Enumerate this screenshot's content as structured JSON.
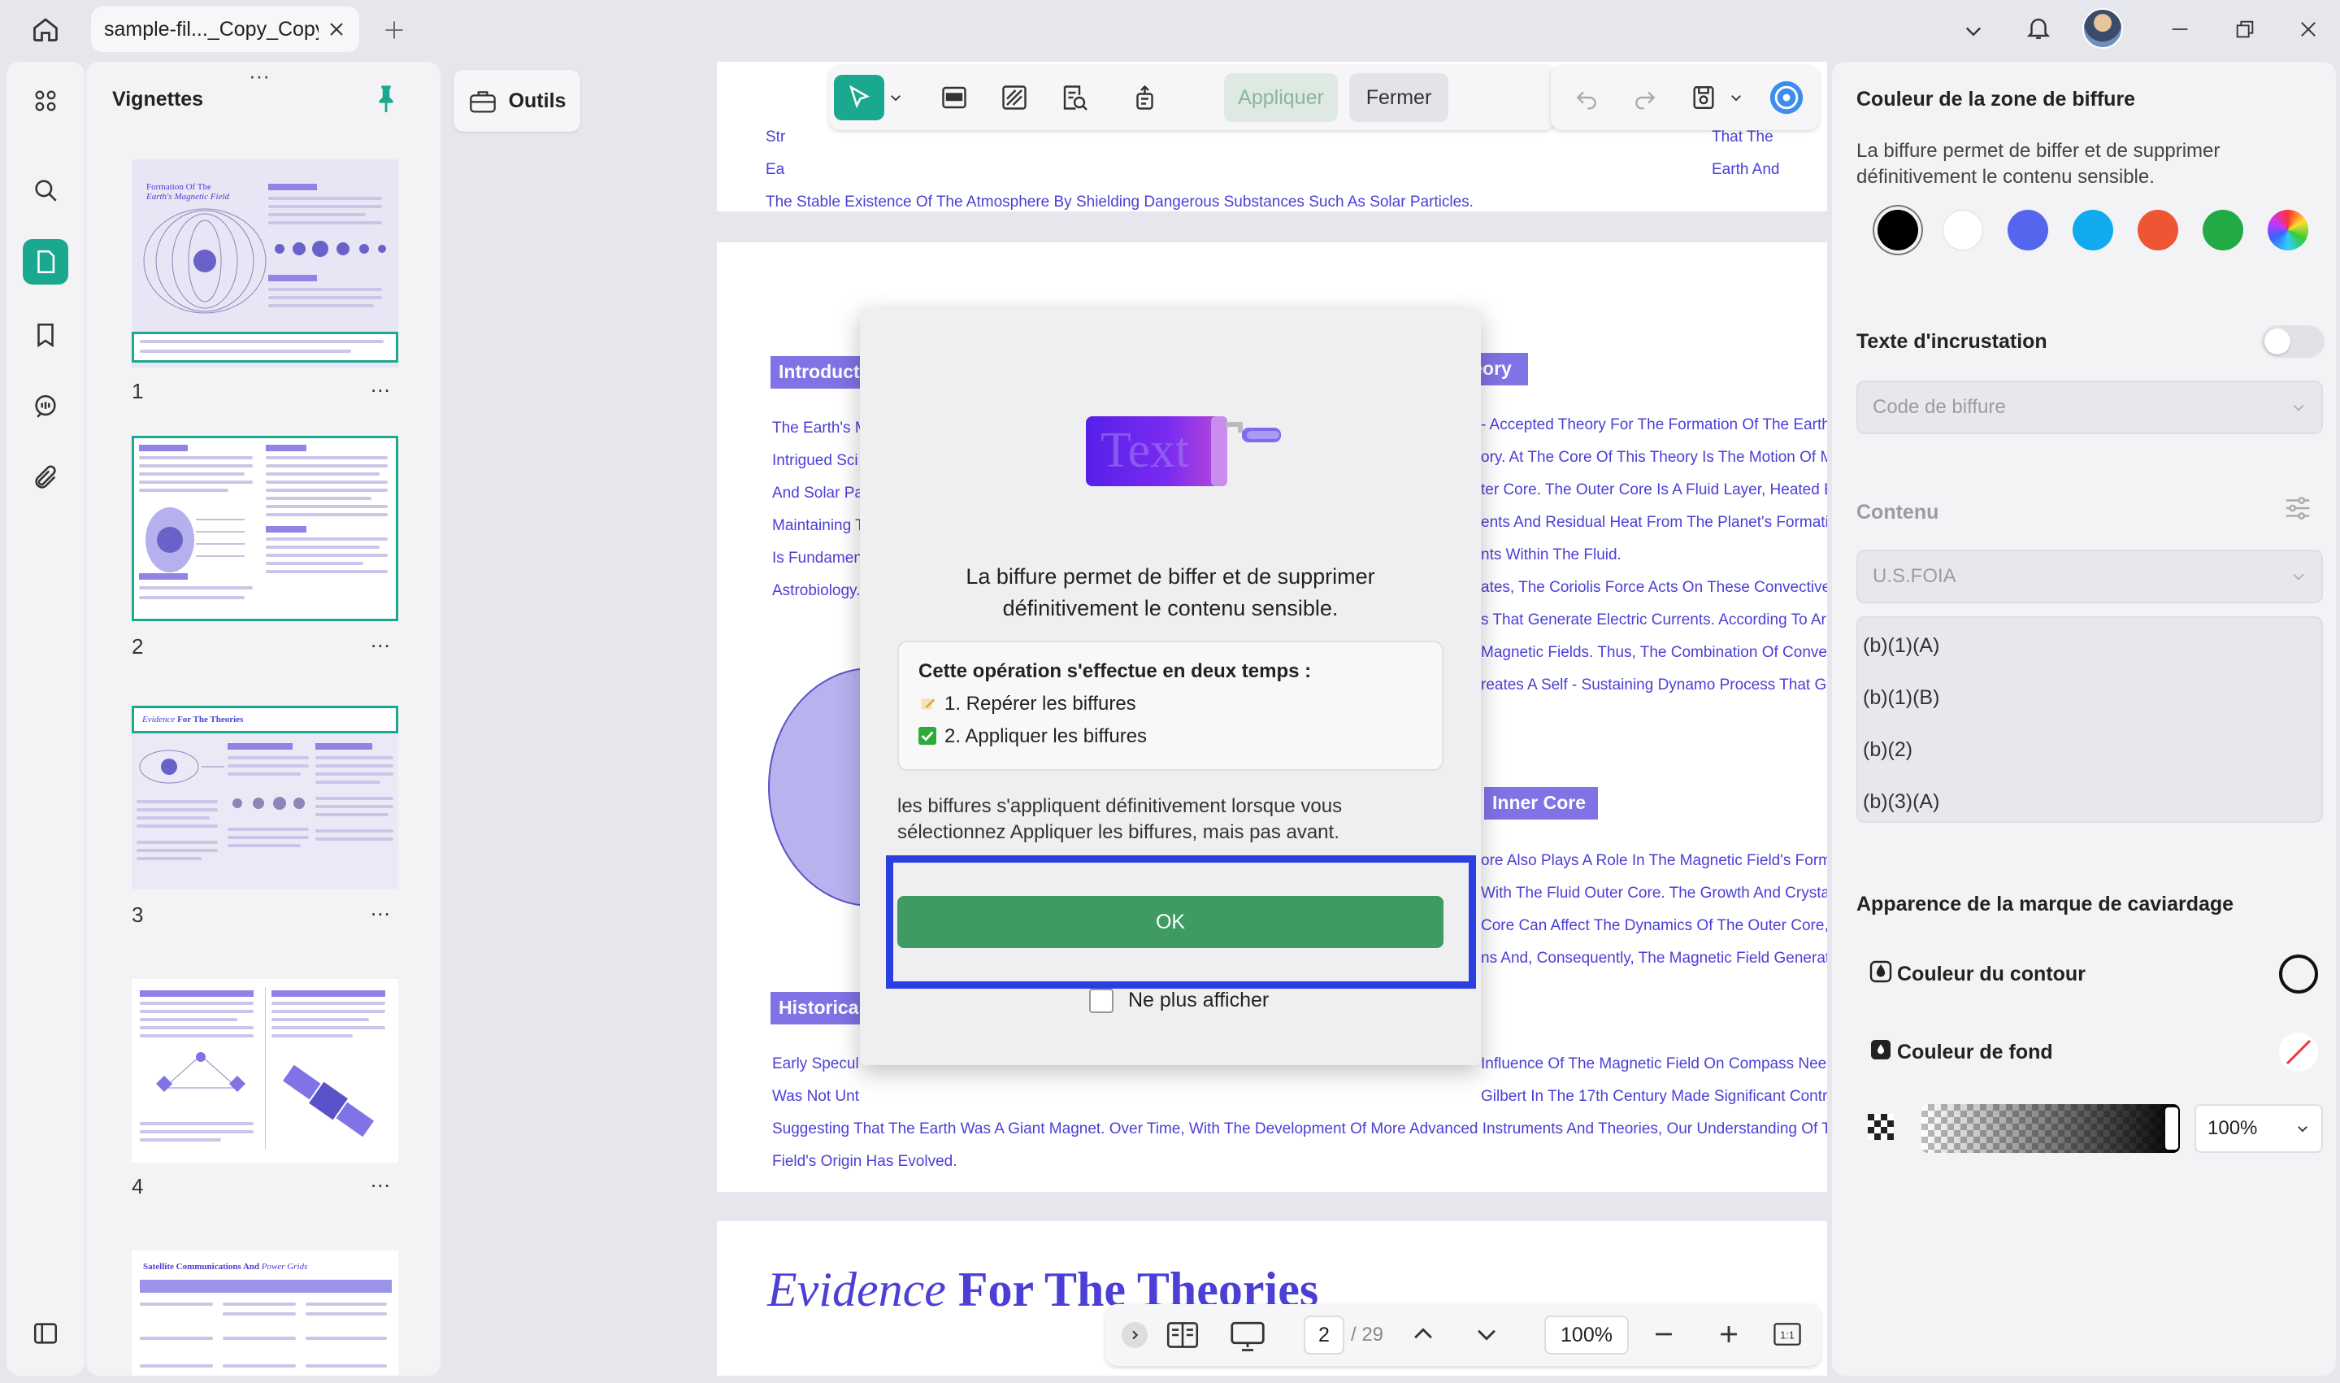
{
  "tab": {
    "title": "sample-fil..._Copy_Copy"
  },
  "sidebar": {
    "title": "Vignettes",
    "pages": [
      "1",
      "2",
      "3",
      "4"
    ],
    "more": "..."
  },
  "tools": {
    "label": "Outils"
  },
  "toolbar": {
    "apply": "Appliquer",
    "close": "Fermer"
  },
  "document": {
    "top_lines": [
      "Str",
      "Ea",
      "The Stable Existence Of The Atmosphere By Shielding Dangerous Substances Such As Solar Particles.",
      "That The",
      "Earth And"
    ],
    "sections": {
      "introduction": "Introductio",
      "dynamo": "Dynamo Theory",
      "inner": "Inner Core",
      "historical": "Historica"
    },
    "left_lines": [
      "The Earth's M",
      "Intrigued Sci",
      "And Solar Pa",
      "Maintaining T",
      "Is Fundamen",
      "Astrobiology."
    ],
    "right_lines": [
      "- Accepted Theory For The Formation Of The Earth",
      "ory. At The Core Of This Theory Is The Motion Of M",
      "ter Core. The Outer Core Is A Fluid Layer, Heated E",
      "ents And Residual Heat From The Planet's Formati",
      "nts Within The Fluid.",
      "ates, The Coriolis Force Acts On These Convective",
      "s That Generate Electric Currents. According To Ar",
      "Magnetic Fields. Thus, The Combination Of Conve",
      "reates A Self - Sustaining Dynamo Process That G"
    ],
    "inner_lines": [
      "ore Also Plays A Role In The Magnetic Field's Form",
      "With The Fluid Outer Core. The Growth And Crysta",
      "Core Can Affect The Dynamics Of The Outer Core,",
      "ns And, Consequently, The Magnetic Field Generat"
    ],
    "hist_left": [
      "Early Specul",
      "Was Not Unt"
    ],
    "hist_right": [
      "Influence Of The Magnetic Field On Compass Need",
      "Gilbert In The 17th Century Made Significant Contri"
    ],
    "hist_full": [
      "Suggesting That The Earth Was A Giant Magnet. Over Time, With The Development Of More Advanced Instruments And Theories, Our Understanding Of Th",
      "Field's Origin Has Evolved."
    ],
    "heading_italic": "Evidence",
    "heading_bold": "For The Theories"
  },
  "dialog": {
    "illustration_text": "Text",
    "message": "La biffure permet de biffer et de supprimer définitivement le contenu sensible.",
    "steps_title": "Cette opération s'effectue en deux temps :",
    "step1": "1. Repérer les biffures",
    "step2": "2. Appliquer les biffures",
    "note": "les biffures s'appliquent définitivement lorsque vous sélectionnez Appliquer les biffures, mais pas avant.",
    "ok": "OK",
    "dont_show": "Ne plus afficher"
  },
  "rightpanel": {
    "color_title": "Couleur de la zone de biffure",
    "color_desc": "La biffure permet de biffer et de supprimer définitivement le contenu sensible.",
    "swatches": [
      "#000000",
      "#ffffff",
      "#5566ee",
      "#11aaee",
      "#ee5533",
      "#22aa44",
      "conic"
    ],
    "overlay_title": "Texte d'incrustation",
    "overlay_placeholder": "Code de biffure",
    "content_title": "Contenu",
    "content_value": "U.S.FOIA",
    "content_items": [
      "(b)(1)(A)",
      "(b)(1)(B)",
      "(b)(2)",
      "(b)(3)(A)"
    ],
    "appearance_title": "Apparence de la marque de caviardage",
    "outline_label": "Couleur du contour",
    "fill_label": "Couleur de fond",
    "opacity": "100%"
  },
  "bottombar": {
    "page": "2",
    "total": "/ 29",
    "zoom": "100%"
  }
}
